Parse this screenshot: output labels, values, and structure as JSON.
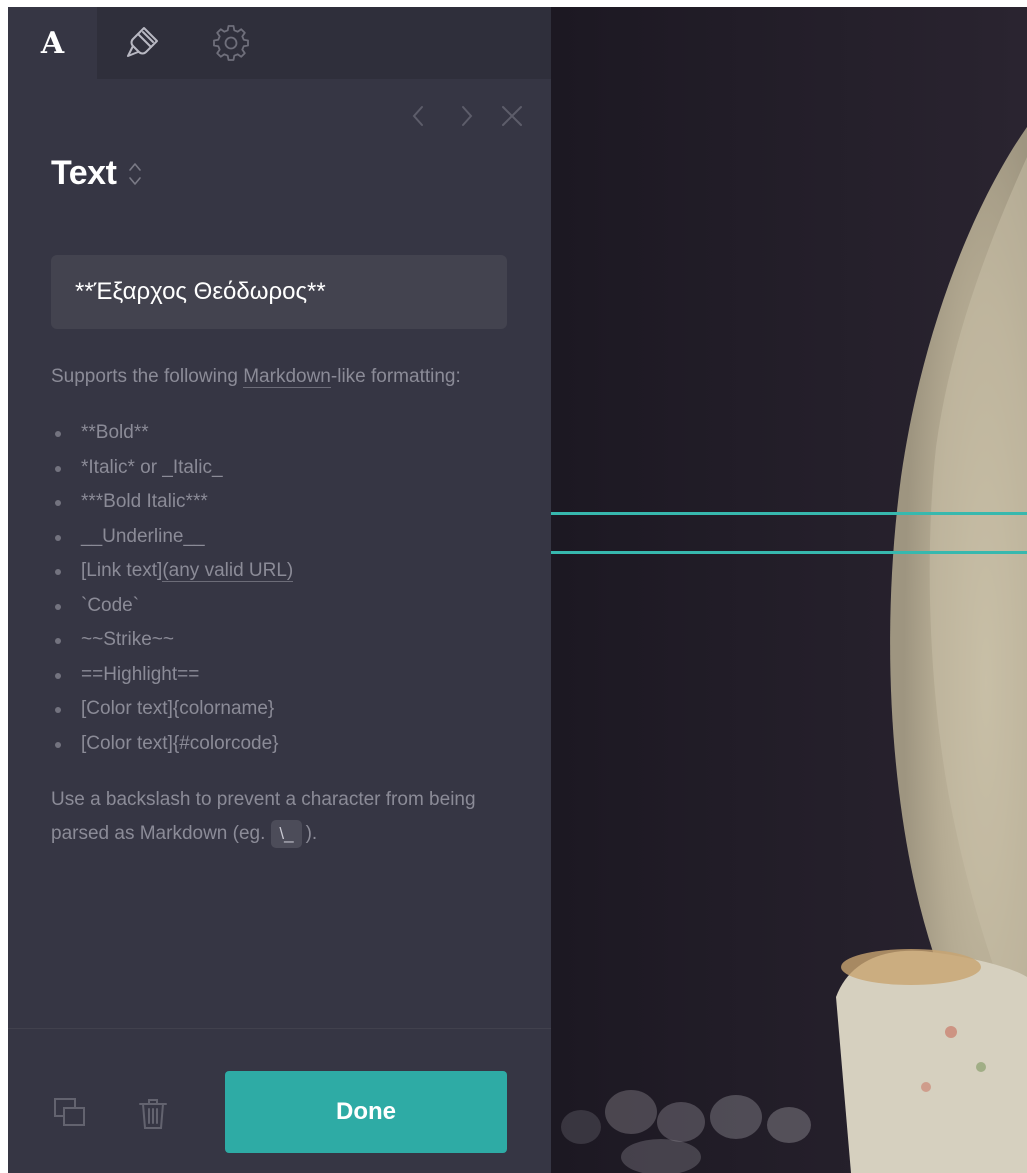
{
  "tabs": [
    {
      "name": "text",
      "glyph": "A",
      "active": true
    },
    {
      "name": "style",
      "icon": "paintbrush-icon",
      "active": false
    },
    {
      "name": "settings",
      "icon": "gear-icon",
      "active": false
    }
  ],
  "nav": {
    "prev_icon": "chevron-left-icon",
    "next_icon": "chevron-right-icon",
    "close_icon": "close-icon"
  },
  "panel": {
    "title": "Text",
    "title_icon": "sort-arrows-icon",
    "text_value": "**Έξαρχος Θεόδωρος**"
  },
  "help": {
    "intro_prefix": "Supports the following ",
    "intro_link": "Markdown",
    "intro_suffix": "-like formatting:",
    "items": [
      "**Bold**",
      "*Italic* or _Italic_",
      "***Bold Italic***",
      "__Underline__",
      "[Link text]",
      "`Code`",
      "~~Strike~~",
      "==Highlight==",
      "[Color text]{colorname}",
      "[Color text]{#colorcode}"
    ],
    "link_url_text": "(any valid URL)",
    "backslash_prefix": "Use a backslash to prevent a character from being parsed as Markdown (eg.",
    "backslash_code": "\\_",
    "backslash_suffix": ")."
  },
  "footer": {
    "duplicate_icon": "duplicate-icon",
    "delete_icon": "trash-icon",
    "done_label": "Done"
  },
  "colors": {
    "panel_bg": "#363644",
    "tabbar_bg": "#2f2f3b",
    "input_bg": "#43434f",
    "accent": "#2eaba5",
    "guide_line": "#37b8ae",
    "muted_text": "#8b8b97"
  }
}
